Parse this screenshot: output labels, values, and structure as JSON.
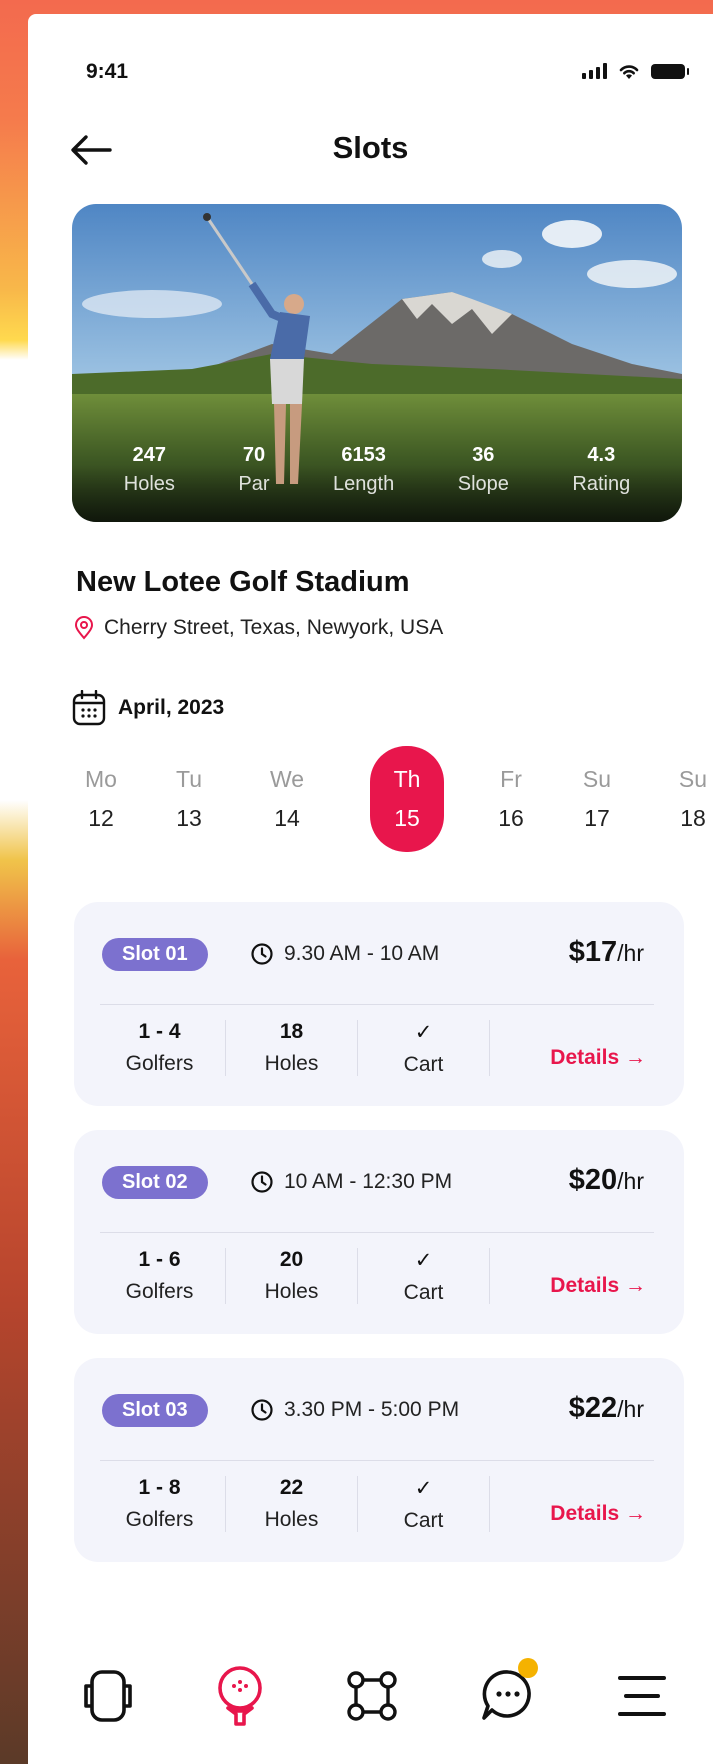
{
  "status_bar": {
    "time": "9:41"
  },
  "header": {
    "title": "Slots"
  },
  "course": {
    "stats": [
      {
        "value": "247",
        "label": "Holes"
      },
      {
        "value": "70",
        "label": "Par"
      },
      {
        "value": "6153",
        "label": "Length"
      },
      {
        "value": "36",
        "label": "Slope"
      },
      {
        "value": "4.3",
        "label": "Rating"
      }
    ],
    "name": "New Lotee Golf Stadium",
    "address": "Cherry Street, Texas, Newyork, USA"
  },
  "calendar": {
    "month": "April, 2023",
    "days": [
      {
        "name": "Mo",
        "date": "12"
      },
      {
        "name": "Tu",
        "date": "13"
      },
      {
        "name": "We",
        "date": "14"
      },
      {
        "name": "Th",
        "date": "15",
        "selected": true
      },
      {
        "name": "Fr",
        "date": "16"
      },
      {
        "name": "Su",
        "date": "17"
      },
      {
        "name": "Su",
        "date": "18"
      }
    ]
  },
  "slots": [
    {
      "tag": "Slot 01",
      "time": "9.30 AM - 10 AM",
      "price": "$17",
      "unit": "/hr",
      "golfers": "1 - 4",
      "golfers_label": "Golfers",
      "holes": "18",
      "holes_label": "Holes",
      "cart_check": "✓",
      "cart_label": "Cart",
      "details": "Details"
    },
    {
      "tag": "Slot 02",
      "time": "10 AM - 12:30 PM",
      "price": "$20",
      "unit": "/hr",
      "golfers": "1 - 6",
      "golfers_label": "Golfers",
      "holes": "20",
      "holes_label": "Holes",
      "cart_check": "✓",
      "cart_label": "Cart",
      "details": "Details"
    },
    {
      "tag": "Slot 03",
      "time": "3.30 PM - 5:00 PM",
      "price": "$22",
      "unit": "/hr",
      "golfers": "1 - 8",
      "golfers_label": "Golfers",
      "holes": "22",
      "holes_label": "Holes",
      "cart_check": "✓",
      "cart_label": "Cart",
      "details": "Details"
    }
  ],
  "colors": {
    "accent": "#e8164c",
    "slot_tag": "#7c71cf",
    "card_bg": "#f3f4fb",
    "badge": "#f5b200"
  },
  "bottom_nav": [
    "phone-icon",
    "golf-ball-icon",
    "scan-icon",
    "chat-icon",
    "menu-icon"
  ]
}
